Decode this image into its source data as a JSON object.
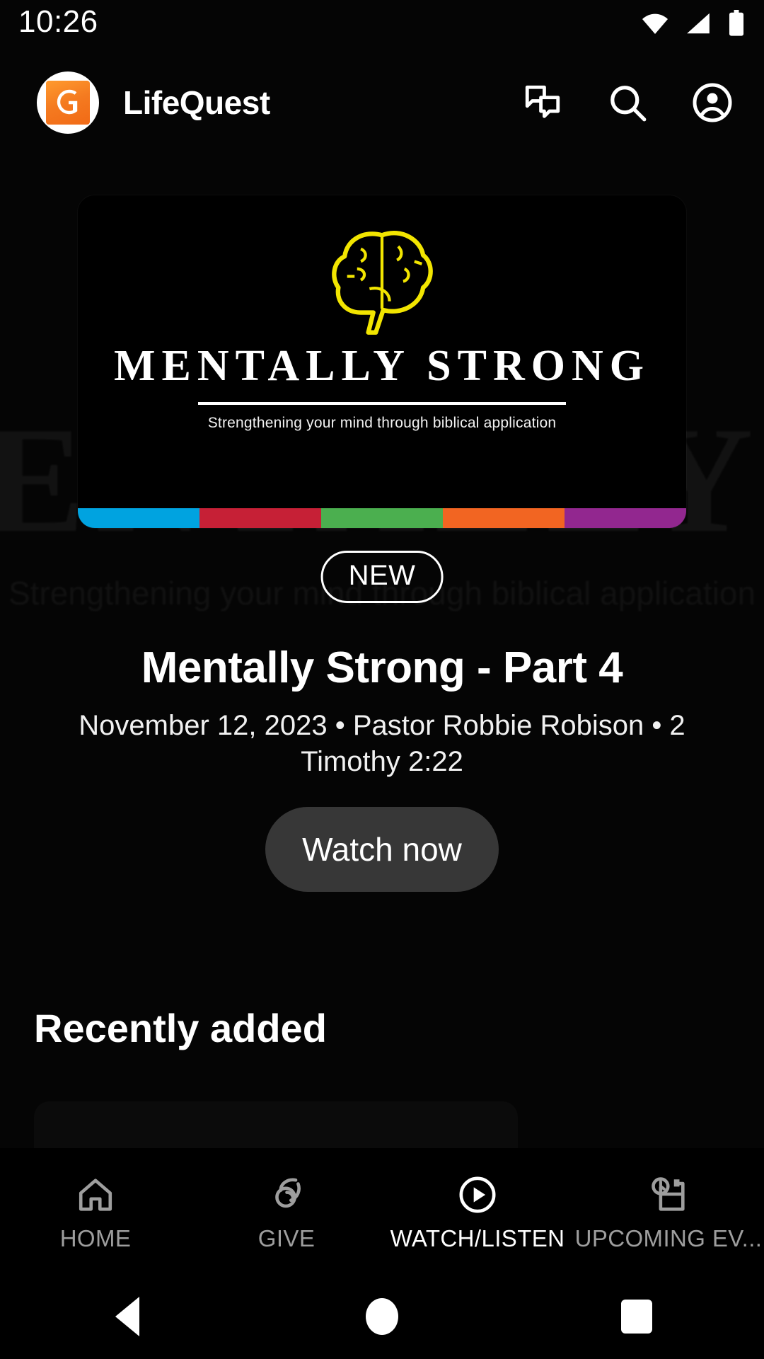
{
  "status_bar": {
    "time": "10:26",
    "icons": [
      "wifi-icon",
      "cell-signal-icon",
      "battery-icon"
    ]
  },
  "app_bar": {
    "brand_name": "LifeQuest",
    "logo_icon": "lifequest-logo-icon",
    "actions": [
      {
        "name": "chat-icon",
        "label": "Chat"
      },
      {
        "name": "search-icon",
        "label": "Search"
      },
      {
        "name": "account-circle-icon",
        "label": "Account"
      }
    ]
  },
  "hero": {
    "badge": "NEW",
    "title": "Mentally Strong - Part 4",
    "meta": "November 12, 2023 • Pastor Robbie Robison • 2 Timothy 2:22",
    "cta_label": "Watch now",
    "artwork": {
      "series_title": "MENTALLY STRONG",
      "tagline": "Strengthening your mind through biblical application",
      "brain_icon": "brain-icon",
      "brain_color": "#F2E500",
      "strip_colors": [
        "#00A3E0",
        "#C62036",
        "#4BAF4F",
        "#F26522",
        "#92278F"
      ]
    }
  },
  "sections": {
    "recently_added_title": "Recently added"
  },
  "bottom_nav": {
    "items": [
      {
        "label": "HOME",
        "icon": "home-icon",
        "active": false
      },
      {
        "label": "GIVE",
        "icon": "volunteer-hand-icon",
        "active": false
      },
      {
        "label": "WATCH/LISTEN",
        "icon": "play-circle-icon",
        "active": true
      },
      {
        "label": "UPCOMING EV...",
        "icon": "upcoming-events-icon",
        "active": false
      }
    ],
    "active_color": "#FFFFFF",
    "inactive_color": "#9E9E9E"
  },
  "system_nav": {
    "buttons": [
      {
        "name": "back-button",
        "icon": "triangle-back-icon"
      },
      {
        "name": "home-button",
        "icon": "circle-home-icon"
      },
      {
        "name": "recents-button",
        "icon": "square-recents-icon"
      }
    ]
  }
}
